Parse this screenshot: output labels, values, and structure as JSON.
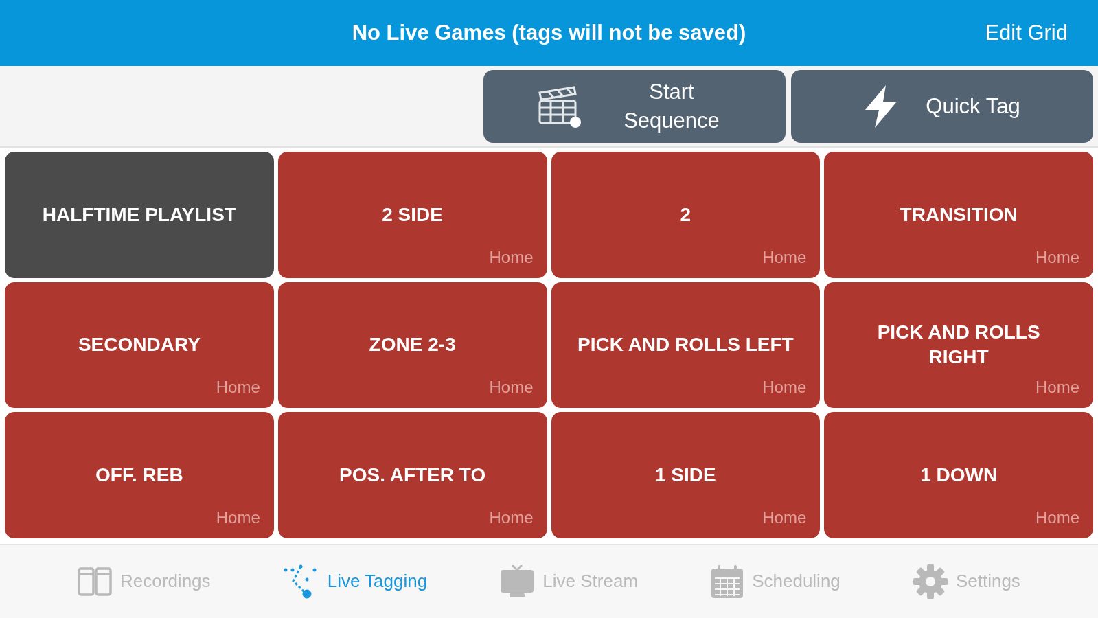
{
  "header": {
    "title": "No Live Games (tags will not be saved)",
    "action": "Edit Grid"
  },
  "toolbar": {
    "buttons": [
      {
        "kind": "sequence",
        "label": "Start Sequence"
      },
      {
        "kind": "quick_tag",
        "label": "Quick Tag"
      }
    ]
  },
  "grid": {
    "tiles": [
      {
        "kind": "playlist",
        "label": "HALFTIME PLAYLIST"
      },
      {
        "kind": "tag",
        "label": "2 SIDE",
        "team": "Home"
      },
      {
        "kind": "tag",
        "label": "2",
        "team": "Home"
      },
      {
        "kind": "tag",
        "label": "TRANSITION",
        "team": "Home"
      },
      {
        "kind": "tag",
        "label": "SECONDARY",
        "team": "Home"
      },
      {
        "kind": "tag",
        "label": "ZONE 2-3",
        "team": "Home"
      },
      {
        "kind": "tag",
        "label": "PICK AND ROLLS LEFT",
        "team": "Home"
      },
      {
        "kind": "tag",
        "label": "PICK AND ROLLS RIGHT",
        "team": "Home"
      },
      {
        "kind": "tag",
        "label": "OFF. REB",
        "team": "Home"
      },
      {
        "kind": "tag",
        "label": "POS. AFTER TO",
        "team": "Home"
      },
      {
        "kind": "tag",
        "label": "1 SIDE",
        "team": "Home"
      },
      {
        "kind": "tag",
        "label": "1 DOWN",
        "team": "Home"
      }
    ]
  },
  "tab_bar": {
    "tabs": [
      {
        "label": "Recordings",
        "selected": false
      },
      {
        "label": "Live Tagging",
        "selected": true
      },
      {
        "label": "Live Stream",
        "selected": false
      },
      {
        "label": "Scheduling",
        "selected": false
      },
      {
        "label": "Settings",
        "selected": false
      }
    ]
  }
}
